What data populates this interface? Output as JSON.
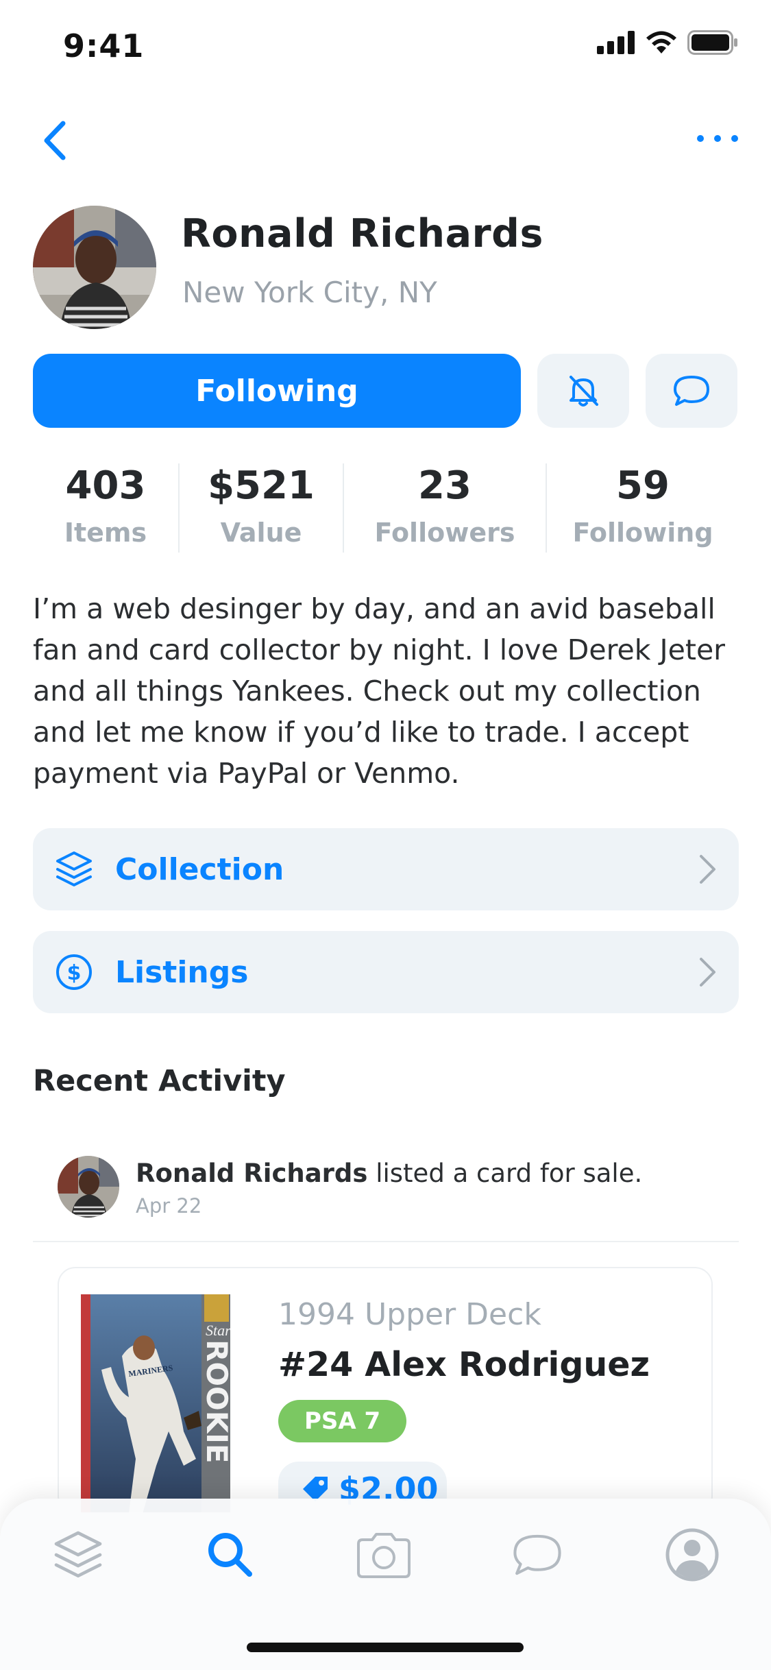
{
  "status": {
    "time": "9:41"
  },
  "profile": {
    "name": "Ronald Richards",
    "location": "New York City, NY",
    "follow_label": "Following"
  },
  "stats": [
    {
      "value": "403",
      "label": "Items"
    },
    {
      "value": "$521",
      "label": "Value"
    },
    {
      "value": "23",
      "label": "Followers"
    },
    {
      "value": "59",
      "label": "Following"
    }
  ],
  "bio": "I’m a web desinger by day, and an avid baseball fan and card collector by night. I love Derek Jeter and all things Yankees. Check out my collection and let me know if you’d like to trade. I accept payment via PayPal or Venmo.",
  "links": [
    {
      "label": "Collection",
      "icon": "layers-icon"
    },
    {
      "label": "Listings",
      "icon": "dollar-circle-icon"
    }
  ],
  "recent_activity": {
    "title": "Recent Activity",
    "item": {
      "actor": "Ronald Richards",
      "action": " listed a card for sale.",
      "date": "Apr 22"
    },
    "card": {
      "year_set": "1994 Upper Deck",
      "title": "#24 Alex Rodriguez",
      "grade": "PSA 7",
      "price": "$2.00",
      "image_text": {
        "star": "Star",
        "rookie": "ROOKIE",
        "team": "MARINERS"
      }
    }
  },
  "tab_bar": {
    "tabs": [
      {
        "icon": "layers-icon",
        "active": false
      },
      {
        "icon": "search-icon",
        "active": true
      },
      {
        "icon": "camera-icon",
        "active": false
      },
      {
        "icon": "chat-bubble-icon",
        "active": false
      },
      {
        "icon": "profile-icon",
        "active": false
      }
    ]
  },
  "colors": {
    "accent": "#0a84ff",
    "grade_badge": "#7bc862",
    "muted_text": "#a4adb5",
    "surface": "#eef3f7"
  }
}
